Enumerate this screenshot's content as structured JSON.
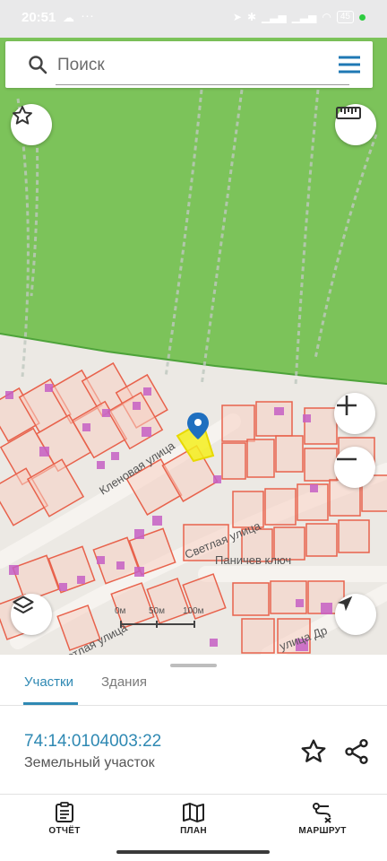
{
  "status_bar": {
    "time": "20:51",
    "dots": "···",
    "battery": "45"
  },
  "search": {
    "placeholder": "Поиск",
    "value": ""
  },
  "map": {
    "street_labels": [
      "Кленовая улица",
      "Светлая улица",
      "Светлая улица",
      "Паничев ключ",
      "улица Др"
    ],
    "scale": {
      "labels": [
        "0м",
        "50м",
        "100м"
      ]
    },
    "colors": {
      "forest": "#7cc35a",
      "parcel_stroke": "#e8624c",
      "parcel_fill": "#f7cfc2",
      "building": "#c55fc4",
      "selected": "#f5ef1e",
      "pin": "#1f6fbf"
    }
  },
  "sheet": {
    "tabs": [
      {
        "label": "Участки",
        "active": true
      },
      {
        "label": "Здания",
        "active": false
      }
    ],
    "parcel": {
      "cadastral_number": "74:14:0104003:22",
      "type": "Земельный участок"
    }
  },
  "bottom_nav": [
    {
      "label": "ОТЧЁТ",
      "icon": "report-icon"
    },
    {
      "label": "ПЛАН",
      "icon": "map-plan-icon"
    },
    {
      "label": "МАРШРУТ",
      "icon": "route-icon"
    }
  ]
}
